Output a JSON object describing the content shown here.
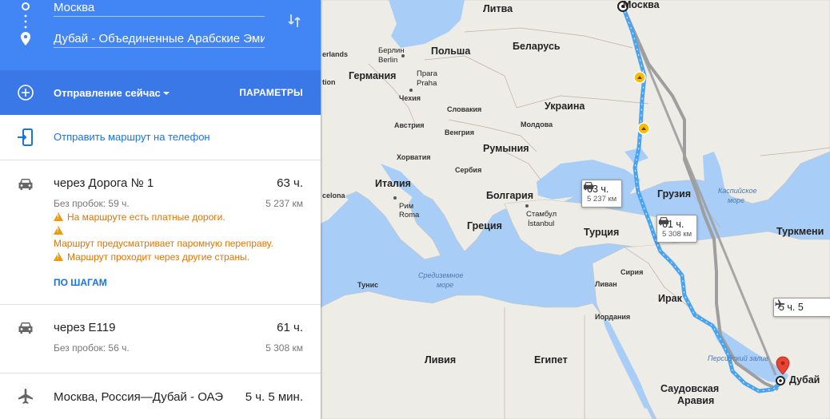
{
  "directions": {
    "origin": "Москва",
    "destination": "Дубай - Объединенные Арабские Эмираты",
    "departure_label": "Отправление сейчас",
    "params_label": "ПАРАМЕТРЫ",
    "send_to_phone": "Отправить маршрут на телефон"
  },
  "routes": [
    {
      "mode_icon": "car-icon",
      "title": "через Дорога № 1",
      "time": "63 ч.",
      "traffic": "Без пробок: 59 ч.",
      "distance": "5 237 км",
      "warnings": [
        "На маршруте есть платные дороги.",
        "",
        "Маршрут предусматривает паромную переправу.",
        "Маршрут проходит через другие страны."
      ],
      "steps_label": "ПО ШАГАМ"
    },
    {
      "mode_icon": "car-icon",
      "title": "через E119",
      "time": "61 ч.",
      "traffic": "Без пробок: 56 ч.",
      "distance": "5 308 км"
    },
    {
      "mode_icon": "airplane-icon",
      "title": "Москва, Россия—Дубай - ОАЭ",
      "time": "5 ч. 5 мин."
    }
  ],
  "map": {
    "countries": {
      "lithuania": "Литва",
      "belarus": "Беларусь",
      "poland": "Польша",
      "germany": "Германия",
      "czech": "Чехия",
      "slovakia": "Словакия",
      "ukraine": "Украина",
      "austria": "Австрия",
      "hungary": "Венгрия",
      "moldova": "Молдова",
      "romania": "Румыния",
      "croatia": "Хорватия",
      "serbia": "Сербия",
      "italy": "Италия",
      "bulgaria": "Болгария",
      "georgia": "Грузия",
      "greece": "Греция",
      "turkey": "Турция",
      "turkmenistan": "Туркмени",
      "tunisia": "Тунис",
      "syria": "Сирия",
      "lebanon": "Ливан",
      "iraq": "Ирак",
      "jordan": "Иордания",
      "libya": "Ливия",
      "egypt": "Египет",
      "saudi_line1": "Саудовская",
      "saudi_line2": "Аравия",
      "netherlands": "erlands",
      "tion": "tion",
      "selona": "celona"
    },
    "cities": {
      "moscow": "Москва",
      "berlin_ru": "Берлин",
      "berlin": "Berlin",
      "prague_ru": "Прага",
      "prague": "Praha",
      "rome_ru": "Рим",
      "rome": "Roma",
      "istanbul_ru": "Стамбул",
      "istanbul": "İstanbul",
      "dubai": "Дубай"
    },
    "seas": {
      "mediterranean_1": "Средиземное",
      "mediterranean_2": "море",
      "caspian_1": "Каспийское",
      "caspian_2": "море",
      "persian_gulf": "Персидский залив"
    },
    "cards": [
      {
        "time": "63 ч.",
        "distance": "5 237 км"
      },
      {
        "time": "61 ч.",
        "distance": "5 308 км"
      },
      {
        "time": "5 ч. 5"
      }
    ],
    "colors": {
      "primary_route": "#4aa3f0",
      "alt_route": "#9e9e9e",
      "header_blue": "#4285f4"
    }
  }
}
